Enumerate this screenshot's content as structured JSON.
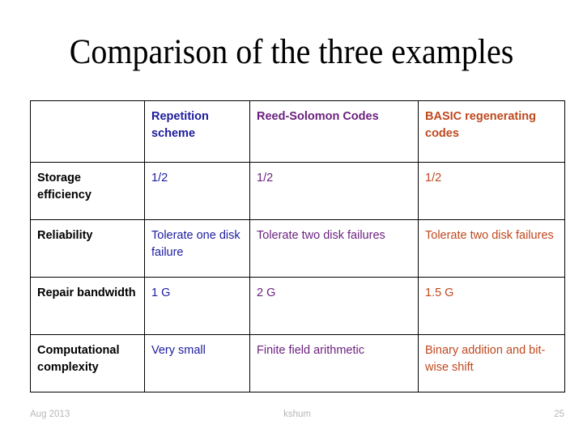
{
  "slide": {
    "title": "Comparison of the three examples"
  },
  "table": {
    "columns": [
      {
        "label": "",
        "color": "#000000",
        "name": "row-header-column"
      },
      {
        "label": "Repetition scheme",
        "color": "#1c1ca0",
        "name": "repetition-scheme"
      },
      {
        "label": "Reed-Solomon Codes",
        "color": "#6a1f7e",
        "name": "reed-solomon-codes"
      },
      {
        "label": "BASIC regenerating codes",
        "color": "#c0481e",
        "name": "basic-regenerating-codes"
      }
    ],
    "rows": [
      {
        "label": "Storage efficiency",
        "values": [
          "1/2",
          "1/2",
          "1/2"
        ]
      },
      {
        "label": "Reliability",
        "values": [
          "Tolerate one disk failure",
          "Tolerate two disk failures",
          "Tolerate two disk failures"
        ]
      },
      {
        "label": "Repair bandwidth",
        "values": [
          "1 G",
          "2 G",
          "1.5 G"
        ]
      },
      {
        "label": "Computational complexity",
        "values": [
          "Very small",
          "Finite field arithmetic",
          "Binary addition and bit-wise shift"
        ]
      }
    ]
  },
  "footer": {
    "date": "Aug 2013",
    "author": "kshum",
    "page_number": "25"
  }
}
